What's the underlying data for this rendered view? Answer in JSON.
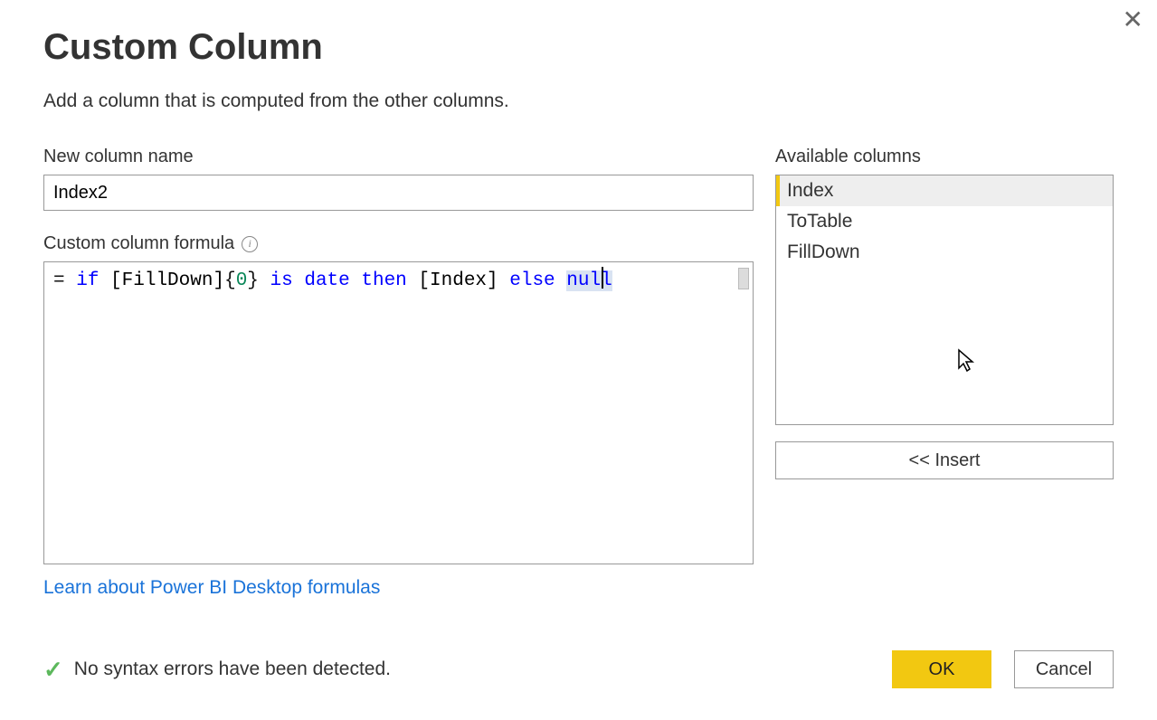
{
  "dialog": {
    "title": "Custom Column",
    "subtitle": "Add a column that is computed from the other columns.",
    "close": "✕"
  },
  "column_name": {
    "label": "New column name",
    "value": "Index2"
  },
  "formula": {
    "label": "Custom column formula",
    "prefix": "= ",
    "tokens": {
      "if": "if",
      "col1": "[FillDown]",
      "brace_open": "{",
      "num": "0",
      "brace_close": "}",
      "is": "is",
      "date": "date",
      "then": "then",
      "col2": "[Index]",
      "else": "else",
      "null": "null"
    }
  },
  "available": {
    "label": "Available columns",
    "items": [
      "Index",
      "ToTable",
      "FillDown"
    ],
    "selected_index": 0,
    "insert_label": "<< Insert"
  },
  "link": {
    "text": "Learn about Power BI Desktop formulas"
  },
  "status": {
    "message": "No syntax errors have been detected.",
    "icon": "✓"
  },
  "buttons": {
    "ok": "OK",
    "cancel": "Cancel"
  }
}
